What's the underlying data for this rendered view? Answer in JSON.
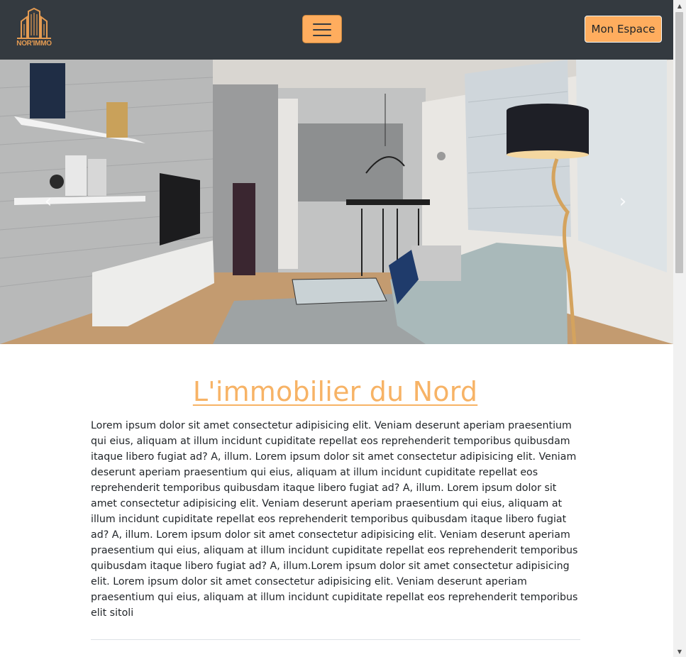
{
  "brand": {
    "logo_text": "NOR'IMMO"
  },
  "navbar": {
    "menu_toggle_label": "",
    "account_button_label": "Mon Espace"
  },
  "carousel": {
    "prev_label": "‹",
    "next_label": "›"
  },
  "main": {
    "title": "L'immobilier du Nord",
    "body": "Lorem ipsum dolor sit amet consectetur adipisicing elit. Veniam deserunt aperiam praesentium qui eius, aliquam at illum incidunt cupiditate repellat eos reprehenderit temporibus quibusdam itaque libero fugiat ad? A, illum. Lorem ipsum dolor sit amet consectetur adipisicing elit. Veniam deserunt aperiam praesentium qui eius, aliquam at illum incidunt cupiditate repellat eos reprehenderit temporibus quibusdam itaque libero fugiat ad? A, illum. Lorem ipsum dolor sit amet consectetur adipisicing elit. Veniam deserunt aperiam praesentium qui eius, aliquam at illum incidunt cupiditate repellat eos reprehenderit temporibus quibusdam itaque libero fugiat ad? A, illum. Lorem ipsum dolor sit amet consectetur adipisicing elit. Veniam deserunt aperiam praesentium qui eius, aliquam at illum incidunt cupiditate repellat eos reprehenderit temporibus quibusdam itaque libero fugiat ad? A, illum.Lorem ipsum dolor sit amet consectetur adipisicing elit. Lorem ipsum dolor sit amet consectetur adipisicing elit. Veniam deserunt aperiam praesentium qui eius, aliquam at illum incidunt cupiditate repellat eos reprehenderit temporibus elit sitoli"
  },
  "scrollbar": {
    "up_icon": "▲",
    "down_icon": "▼"
  },
  "colors": {
    "navbar_bg": "#343a40",
    "accent": "#ffad5e",
    "title": "#f7b366",
    "logo": "#e49b52"
  }
}
